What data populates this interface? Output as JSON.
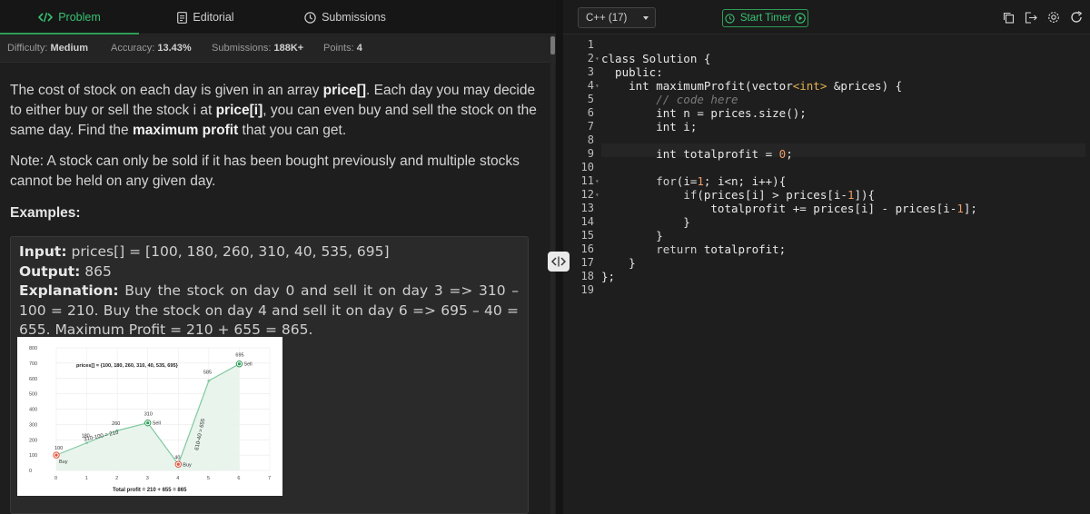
{
  "tabs": [
    {
      "label": "Problem",
      "icon": "code-icon",
      "active": true
    },
    {
      "label": "Editorial",
      "icon": "document-icon",
      "active": false
    },
    {
      "label": "Submissions",
      "icon": "clock-icon",
      "active": false
    }
  ],
  "meta": {
    "difficulty_label": "Difficulty:",
    "difficulty_value": "Medium",
    "accuracy_label": "Accuracy:",
    "accuracy_value": "13.43%",
    "submissions_label": "Submissions:",
    "submissions_value": "188K+",
    "points_label": "Points:",
    "points_value": "4"
  },
  "problem": {
    "p1": "The cost of stock on each day is given in an array ",
    "price_arr": "price[]",
    "p2": ". Each day you may decide to either buy or sell the stock i at ",
    "price_i": "price[i]",
    "p3": ", you can even buy and sell the stock on the same day. Find the ",
    "max_profit": "maximum profit",
    "p4": " that you can get.",
    "note": "Note: A stock can only be sold if it has been bought previously and multiple stocks cannot be held on any given day.",
    "examples_heading": "Examples:"
  },
  "example": {
    "input_label": "Input:",
    "input_value": " prices[] = [100, 180, 260, 310, 40, 535, 695]",
    "output_label": "Output:",
    "output_value": " 865",
    "explanation_label": "Explanation:",
    "explanation_value": " Buy the stock on day 0 and sell it on day 3 => 310 – 100 = 210. Buy the stock on day 4 and sell it on day 6 => 695 – 40 = 655. Maximum Profit = 210 + 655 = 865."
  },
  "chart_data": {
    "type": "line",
    "title": "prices[] = {100, 180, 260, 310, 40, 535, 695}",
    "xlabel": "Total profit = 210 + 655 = 865",
    "ylabel": "",
    "x": [
      0,
      1,
      2,
      3,
      4,
      5,
      6
    ],
    "values": [
      100,
      180,
      260,
      310,
      40,
      585,
      695
    ],
    "ylim": [
      0,
      800
    ],
    "xlim": [
      0,
      7
    ],
    "x_ticks": [
      "0",
      "1",
      "2",
      "3",
      "4",
      "5",
      "6",
      "7"
    ],
    "y_ticks": [
      "0",
      "100",
      "200",
      "300",
      "400",
      "500",
      "600",
      "700",
      "800"
    ],
    "point_labels": [
      "100",
      "180",
      "260",
      "310",
      "40",
      "585",
      "695"
    ],
    "markers": [
      {
        "x": 0,
        "label": "Buy"
      },
      {
        "x": 3,
        "label": "Sell"
      },
      {
        "x": 4,
        "label": "Buy"
      },
      {
        "x": 6,
        "label": "Sell"
      }
    ],
    "annotations": [
      "310-100 = 210",
      "610-40 = 655"
    ],
    "grid": true,
    "colors": {
      "line": "#7fc9a0",
      "area": "#e6f3ea",
      "buy": "#e0523a",
      "sell": "#2e9d57"
    }
  },
  "editor": {
    "language": "C++ (17)",
    "timer_label": "Start Timer",
    "tools": [
      "copy-icon",
      "exit-icon",
      "settings-icon",
      "refresh-icon"
    ],
    "lines": [
      "",
      "class Solution {",
      "  public:",
      "    int maximumProfit(vector<int> &prices) {",
      "        // code here",
      "        int n = prices.size();",
      "        int i;",
      "",
      "        int totalprofit = 0;",
      "",
      "        for(i=1; i<n; i++){",
      "            if(prices[i] > prices[i-1]){",
      "                totalprofit += prices[i] - prices[i-1];",
      "            }",
      "        }",
      "        return totalprofit;",
      "    }",
      "};",
      ""
    ],
    "folds": [
      2,
      4,
      11,
      12
    ]
  },
  "colors": {
    "accent": "#2e9d57",
    "background": "#1e1e1e"
  }
}
